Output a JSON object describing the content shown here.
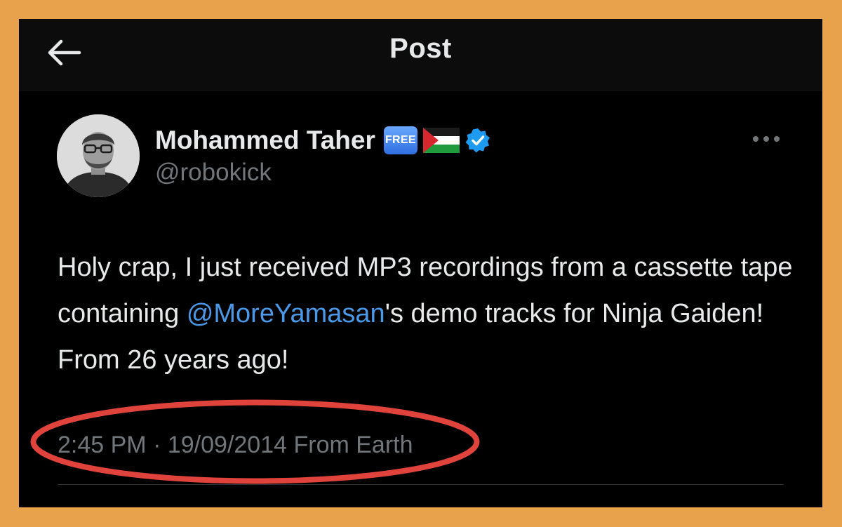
{
  "header": {
    "title": "Post",
    "back_icon": "arrow-left-icon"
  },
  "post": {
    "author": {
      "display_name": "Mohammed Taher",
      "badge_text": "FREE",
      "flag_icon": "palestine-flag-icon",
      "verified_icon": "verified-badge-icon",
      "handle": "@robokick"
    },
    "more_icon": "more-horizontal-icon",
    "text_before": "Holy crap, I just received MP3 recordings from a cassette tape containing ",
    "mention": "@MoreYamasan",
    "text_after": "'s demo tracks for Ninja Gaiden! From 26 years ago!",
    "time": "2:45 PM",
    "separator": "·",
    "date": "19/09/2014",
    "source": "From Earth"
  },
  "colors": {
    "frame": "#E8A24C",
    "background": "#000000",
    "text_primary": "#E7E9EA",
    "text_secondary": "#71767B",
    "link": "#4A99E9",
    "annotation": "#E0433B"
  }
}
